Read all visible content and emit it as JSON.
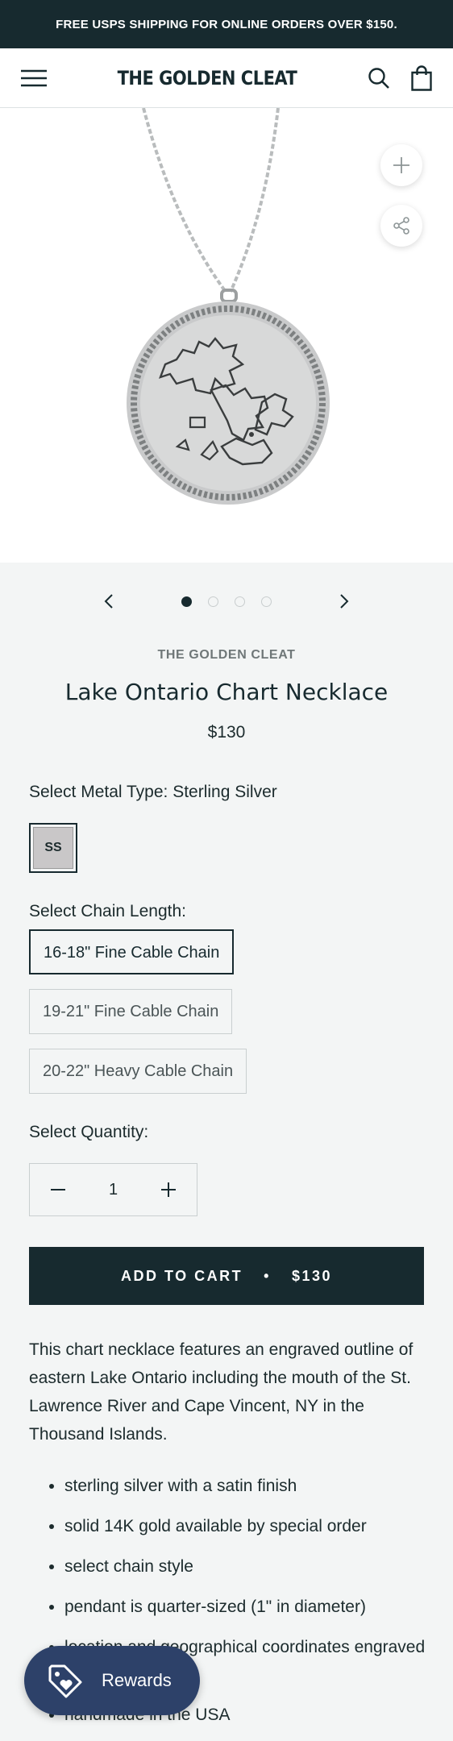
{
  "announcement": "FREE USPS SHIPPING FOR ONLINE ORDERS OVER $150.",
  "header": {
    "logo": "THE GOLDEN CLEAT"
  },
  "gallery": {
    "slide_count": 4,
    "active_slide": 1
  },
  "product": {
    "vendor": "THE GOLDEN CLEAT",
    "title": "Lake Ontario Chart Necklace",
    "price": "$130"
  },
  "options": {
    "metal_label": "Select Metal Type: Sterling Silver",
    "metal_swatch": "SS",
    "chain_label": "Select Chain Length:",
    "chains": [
      "16-18\" Fine Cable Chain",
      "19-21\" Fine Cable Chain",
      "20-22\" Heavy Cable Chain"
    ],
    "quantity_label": "Select Quantity:",
    "quantity": "1"
  },
  "cart": {
    "label": "ADD TO CART",
    "sep": "•",
    "price": "$130"
  },
  "description": "This chart necklace features an engraved outline of eastern Lake Ontario including the mouth of the St. Lawrence River and Cape Vincent, NY in the Thousand Islands.",
  "bullets": [
    "sterling silver with a satin finish",
    "solid 14K gold available by special order",
    "select chain style",
    "pendant is quarter-sized (1\" in diameter)",
    "location and geographical coordinates engraved on back",
    "handmade in the USA"
  ],
  "rewards": {
    "label": "Rewards"
  },
  "colors": {
    "dark": "#172a2f",
    "rewards": "#2d4169",
    "bg": "#f3f5f5"
  }
}
